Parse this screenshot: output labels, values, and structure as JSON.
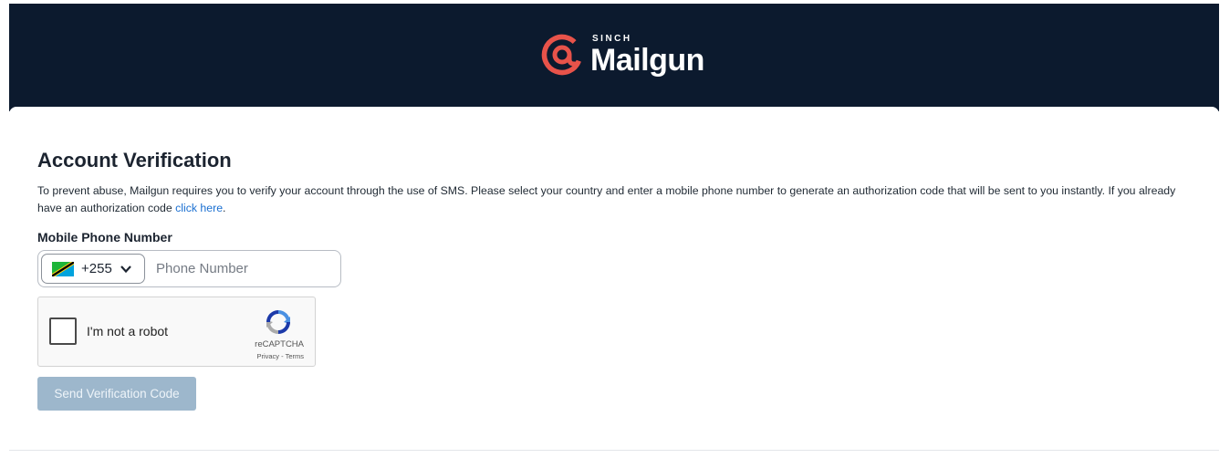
{
  "header": {
    "brand_parent": "SINCH",
    "brand_name": "Mailgun",
    "brand_color": "#e8534a",
    "background_color": "#0c1a2e"
  },
  "main": {
    "title": "Account Verification",
    "description": "To prevent abuse, Mailgun requires you to verify your account through the use of SMS. Please select your country and enter a mobile phone number to generate an authorization code that will be sent to you instantly. If you already have an authorization code ",
    "description_link": "click here",
    "description_end": ".",
    "phone_label": "Mobile Phone Number",
    "country_code": "+255",
    "country_flag": "tanzania-flag-icon",
    "phone_placeholder": "Phone Number",
    "phone_value": "",
    "captcha": {
      "label": "I'm not a robot",
      "brand": "reCAPTCHA",
      "privacy": "Privacy",
      "separator": " - ",
      "terms": "Terms",
      "checked": false
    },
    "send_button": "Send Verification Code",
    "send_button_disabled": true,
    "link_color": "#1a6fd1"
  }
}
